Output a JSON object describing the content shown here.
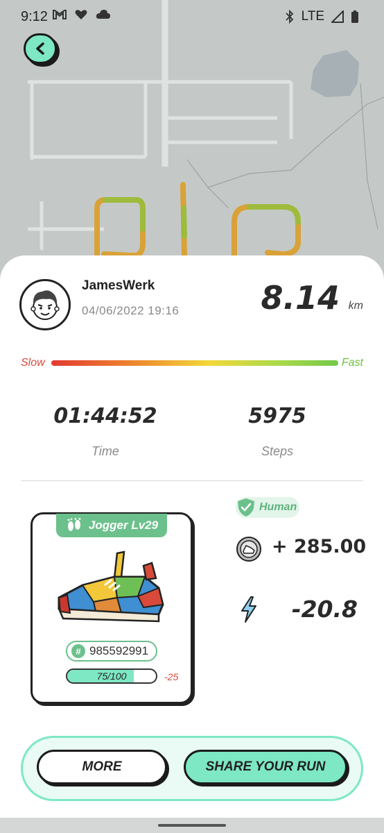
{
  "status_bar": {
    "time": "9:12",
    "network": "LTE"
  },
  "map": {
    "route_colors": [
      "#e5a32f",
      "#8ec23c",
      "#f0c84a"
    ]
  },
  "profile": {
    "username": "JamesWerk",
    "datetime": "04/06/2022 19:16"
  },
  "run": {
    "distance": "8.14",
    "distance_unit": "km",
    "slow_label": "Slow",
    "fast_label": "Fast",
    "time_value": "01:44:52",
    "time_label": "Time",
    "steps_value": "5975",
    "steps_label": "Steps"
  },
  "sneaker": {
    "type_label": "Jogger Lv29",
    "id": "985592991",
    "durability": "75/100",
    "durability_fraction": 0.75,
    "durability_delta": "-25"
  },
  "rewards": {
    "badge": "Human",
    "gst_earned": "+ 285.00",
    "energy_used": "-20.8"
  },
  "actions": {
    "more_label": "MORE",
    "share_label": "SHARE YOUR RUN"
  },
  "colors": {
    "accent": "#7de8c3",
    "green": "#6cc08c",
    "slow": "#d84a3a",
    "fast": "#6cbf3f"
  }
}
